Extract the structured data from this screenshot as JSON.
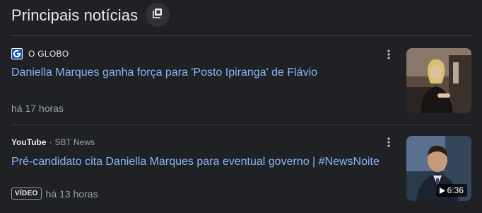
{
  "header": {
    "title": "Principais notícias",
    "icon": "stacked-pages-icon"
  },
  "articles": [
    {
      "source": "O GLOBO",
      "favicon": "o-globo-logo-icon",
      "headline": "Daniella Marques ganha força para 'Posto Ipiranga' de Flávio",
      "time": "há 17 horas",
      "thumbnail": "woman-at-podium-photo"
    },
    {
      "source": "YouTube",
      "source_sub": "SBT News",
      "headline": "Pré-candidato cita Daniella Marques para eventual governo | #NewsNoite",
      "badge": "VÍDEO",
      "time": "há 13 horas",
      "duration": "6:36",
      "thumbnail": "man-in-suit-video-thumbnail"
    }
  ],
  "colors": {
    "background": "#202124",
    "link": "#8ab4f8",
    "muted": "#9aa0a6"
  }
}
